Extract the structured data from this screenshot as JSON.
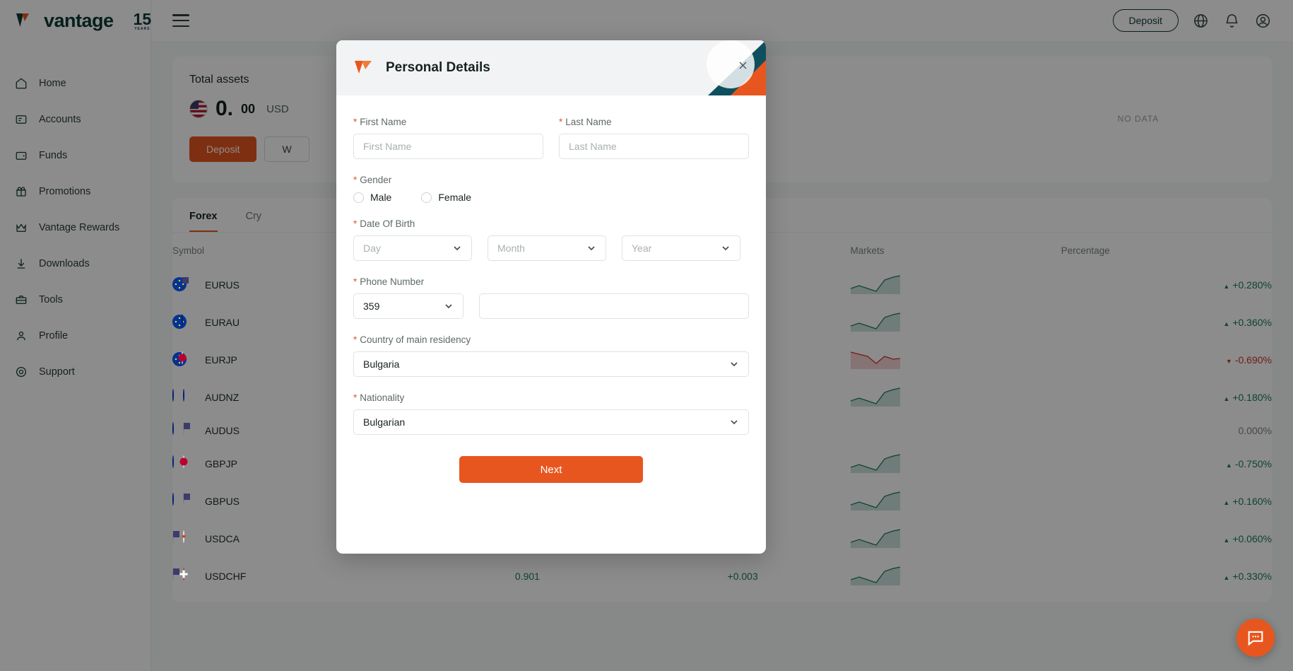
{
  "sidebar": {
    "brand": {
      "name": "vantage",
      "badge": "15",
      "badge_sub": "YEARS"
    },
    "items": [
      {
        "label": "Home",
        "icon": "home-icon"
      },
      {
        "label": "Accounts",
        "icon": "accounts-icon"
      },
      {
        "label": "Funds",
        "icon": "wallet-icon"
      },
      {
        "label": "Promotions",
        "icon": "gift-icon"
      },
      {
        "label": "Vantage Rewards",
        "icon": "crown-icon"
      },
      {
        "label": "Downloads",
        "icon": "download-icon"
      },
      {
        "label": "Tools",
        "icon": "toolbox-icon"
      },
      {
        "label": "Profile",
        "icon": "person-icon"
      },
      {
        "label": "Support",
        "icon": "support-icon"
      }
    ]
  },
  "topbar": {
    "deposit_label": "Deposit",
    "icons": [
      "globe-icon",
      "bell-icon",
      "account-circle-icon"
    ]
  },
  "assets": {
    "title": "Total assets",
    "amount_int": "0.",
    "amount_dec": "00",
    "currency": "USD",
    "deposit_label": "Deposit",
    "withdraw_label": "W",
    "no_data": "NO DATA"
  },
  "market": {
    "tabs": [
      {
        "label": "Forex",
        "active": true
      },
      {
        "label": "Cry",
        "active": false
      }
    ],
    "columns": [
      "Symbol",
      "Markets",
      "Percentage"
    ],
    "rows": [
      {
        "symbol": "EURUS",
        "flag_a": "f-eu",
        "flag_b": "f-us",
        "bid": "",
        "change": "",
        "trend": "up",
        "pct": "+0.280%",
        "dir": "up"
      },
      {
        "symbol": "EURAU",
        "flag_a": "f-eu",
        "flag_b": "f-au",
        "bid": "",
        "change": "",
        "trend": "up",
        "pct": "+0.360%",
        "dir": "up"
      },
      {
        "symbol": "EURJP",
        "flag_a": "f-eu",
        "flag_b": "f-jp",
        "bid": "",
        "change": "",
        "trend": "down",
        "pct": "-0.690%",
        "dir": "down"
      },
      {
        "symbol": "AUDNZ",
        "flag_a": "f-au",
        "flag_b": "f-nz",
        "bid": "",
        "change": "",
        "trend": "up",
        "pct": "+0.180%",
        "dir": "up"
      },
      {
        "symbol": "AUDUS",
        "flag_a": "f-au",
        "flag_b": "f-us",
        "bid": "",
        "change": "",
        "trend": "flat",
        "pct": "0.000%",
        "dir": "flat"
      },
      {
        "symbol": "GBPJP",
        "flag_a": "f-gb",
        "flag_b": "f-jp",
        "bid": "",
        "change": "",
        "trend": "up",
        "pct": "-0.750%",
        "dir": "up"
      },
      {
        "symbol": "GBPUS",
        "flag_a": "f-gb",
        "flag_b": "f-us",
        "bid": "",
        "change": "",
        "trend": "up",
        "pct": "+0.160%",
        "dir": "up"
      },
      {
        "symbol": "USDCA",
        "flag_a": "f-us",
        "flag_b": "f-ca",
        "bid": "",
        "change": "",
        "trend": "up",
        "pct": "+0.060%",
        "dir": "up"
      },
      {
        "symbol": "USDCHF",
        "flag_a": "f-us",
        "flag_b": "f-ch",
        "bid": "0.901",
        "change": "+0.003",
        "trend": "up",
        "pct": "+0.330%",
        "dir": "up"
      }
    ]
  },
  "modal": {
    "title": "Personal Details",
    "close_icon": "close-icon",
    "first_name": {
      "label": "First Name",
      "placeholder": "First Name",
      "value": "",
      "required": "*"
    },
    "last_name": {
      "label": "Last Name",
      "placeholder": "Last Name",
      "value": "",
      "required": "*"
    },
    "gender": {
      "label": "Gender",
      "required": "*",
      "options": [
        {
          "label": "Male",
          "selected": false
        },
        {
          "label": "Female",
          "selected": false
        }
      ]
    },
    "dob": {
      "label": "Date Of Birth",
      "required": "*",
      "day": "Day",
      "month": "Month",
      "year": "Year"
    },
    "phone": {
      "label": "Phone Number",
      "required": "*",
      "code": "359",
      "number": ""
    },
    "country": {
      "label": "Country of main residency",
      "required": "*",
      "value": "Bulgaria"
    },
    "nationality": {
      "label": "Nationality",
      "required": "*",
      "value": "Bulgarian"
    },
    "next_label": "Next"
  },
  "colors": {
    "accent": "#e8561f",
    "brand_dark": "#0e3a36",
    "up": "#1a7a5e",
    "down": "#d0342c",
    "flat": "#7b8785"
  },
  "chat": {
    "icon": "chat-icon"
  }
}
